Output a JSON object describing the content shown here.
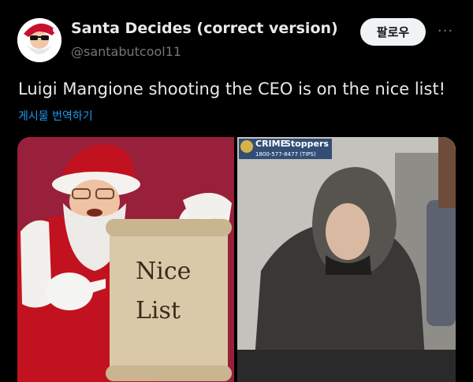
{
  "account": {
    "display_name": "Santa Decides (correct version)",
    "handle": "@santabutcool11"
  },
  "actions": {
    "follow_label": "팔로우",
    "more_label": "···"
  },
  "tweet": {
    "text": "Luigi Mangione shooting the CEO is on the nice list!",
    "translate_label": "게시물 번역하기"
  },
  "media": {
    "left_image": {
      "scroll_line1": "Nice",
      "scroll_line2": "List"
    },
    "right_image": {
      "logo_crime": "CRIME",
      "logo_stoppers": "Stoppers",
      "logo_phone": "1800-577-8477 (TIPS)"
    }
  },
  "colors": {
    "background": "#000000",
    "follow_button_bg": "#eff3f4",
    "link": "#1d9bf0",
    "secondary_text": "#71767b"
  }
}
